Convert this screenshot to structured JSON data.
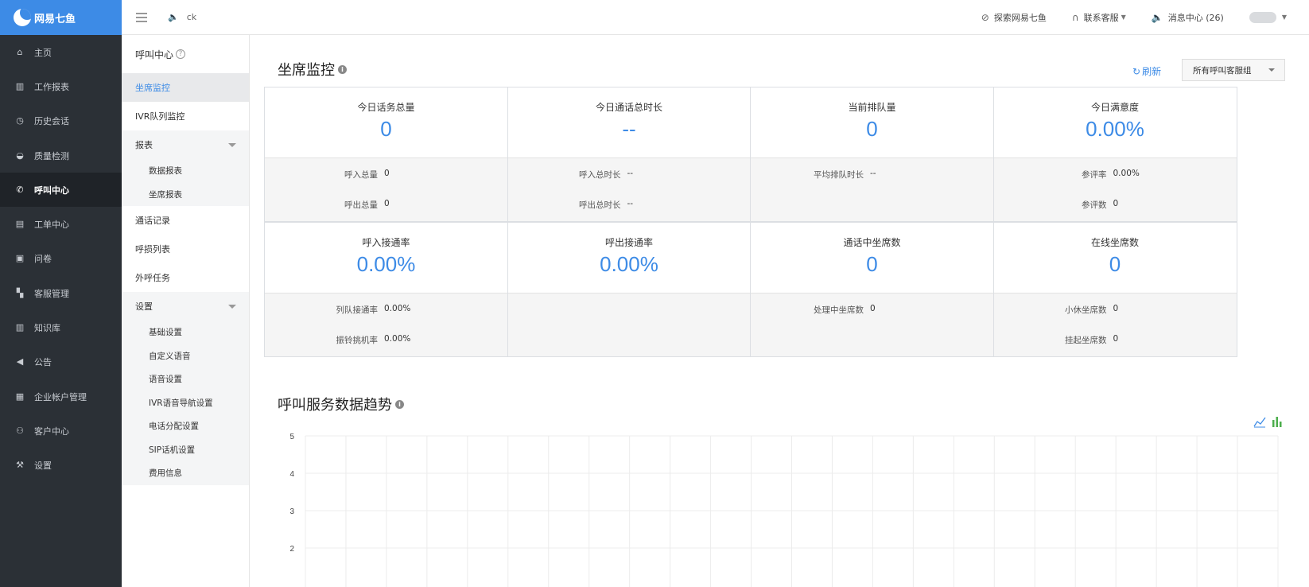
{
  "brand": {
    "name": "网易七鱼"
  },
  "leftnav": [
    {
      "label": "主页",
      "icon": "home-icon",
      "glyph": "⌂"
    },
    {
      "label": "工作报表",
      "icon": "bar-chart-icon",
      "glyph": "▥"
    },
    {
      "label": "历史会话",
      "icon": "clock-icon",
      "glyph": "◷"
    },
    {
      "label": "质量检测",
      "icon": "gauge-icon",
      "glyph": "◒"
    },
    {
      "label": "呼叫中心",
      "icon": "phone-icon",
      "glyph": "✆",
      "active": true
    },
    {
      "label": "工单中心",
      "icon": "ticket-icon",
      "glyph": "▤"
    },
    {
      "label": "问卷",
      "icon": "survey-icon",
      "glyph": "▣"
    },
    {
      "label": "客服管理",
      "icon": "dashboard-icon",
      "glyph": "▚"
    },
    {
      "label": "知识库",
      "icon": "book-icon",
      "glyph": "▥"
    },
    {
      "label": "公告",
      "icon": "speaker-icon",
      "glyph": "◀"
    },
    {
      "label": "企业帐户管理",
      "icon": "building-icon",
      "glyph": "▦"
    },
    {
      "label": "客户中心",
      "icon": "users-icon",
      "glyph": "⚇"
    },
    {
      "label": "设置",
      "icon": "wrench-icon",
      "glyph": "⚒"
    }
  ],
  "topbar": {
    "announcement": "ck",
    "explore": "探索网易七鱼",
    "contact": "联系客服",
    "messages": "消息中心 (26)"
  },
  "subnav": {
    "title": "呼叫中心",
    "items": {
      "seat_monitor": "坐席监控",
      "ivr_monitor": "IVR队列监控",
      "reports": "报表",
      "data_report": "数据报表",
      "seat_report": "坐席报表",
      "call_records": "通话记录",
      "missed_list": "呼损列表",
      "outbound_tasks": "外呼任务",
      "settings": "设置",
      "basic_settings": "基础设置",
      "custom_voice": "自定义语音",
      "voice_settings": "语音设置",
      "ivr_nav": "IVR语音导航设置",
      "call_dist": "电话分配设置",
      "sip_phone": "SIP话机设置",
      "billing": "费用信息"
    }
  },
  "main": {
    "title": "坐席监控",
    "refresh": "刷新",
    "group_select": "所有呼叫客服组",
    "trend_title": "呼叫服务数据趋势"
  },
  "cards": [
    {
      "label": "今日话务总量",
      "value": "0",
      "rows": [
        {
          "label": "呼入总量",
          "value": "0"
        },
        {
          "label": "呼出总量",
          "value": "0"
        }
      ]
    },
    {
      "label": "今日通话总时长",
      "value": "--",
      "rows": [
        {
          "label": "呼入总时长",
          "value": "--"
        },
        {
          "label": "呼出总时长",
          "value": "--"
        }
      ]
    },
    {
      "label": "当前排队量",
      "value": "0",
      "rows": [
        {
          "label": "平均排队时长",
          "value": "--"
        }
      ]
    },
    {
      "label": "今日满意度",
      "value": "0.00%",
      "rows": [
        {
          "label": "参评率",
          "value": "0.00%"
        },
        {
          "label": "参评数",
          "value": "0"
        }
      ]
    },
    {
      "label": "呼入接通率",
      "value": "0.00%",
      "rows": [
        {
          "label": "列队接通率",
          "value": "0.00%"
        },
        {
          "label": "振铃挑机率",
          "value": "0.00%"
        }
      ]
    },
    {
      "label": "呼出接通率",
      "value": "0.00%",
      "rows": []
    },
    {
      "label": "通话中坐席数",
      "value": "0",
      "rows": [
        {
          "label": "处理中坐席数",
          "value": "0"
        }
      ]
    },
    {
      "label": "在线坐席数",
      "value": "0",
      "rows": [
        {
          "label": "小休坐席数",
          "value": "0"
        },
        {
          "label": "挂起坐席数",
          "value": "0"
        }
      ]
    }
  ],
  "chart_data": {
    "type": "line",
    "y_ticks": [
      "5",
      "4",
      "3",
      "2"
    ],
    "ylim": [
      0,
      5
    ],
    "grid": true,
    "series": []
  },
  "colors": {
    "accent": "#3d8be6",
    "sidebar": "#2b3036",
    "green_icon": "#4cae4c"
  }
}
